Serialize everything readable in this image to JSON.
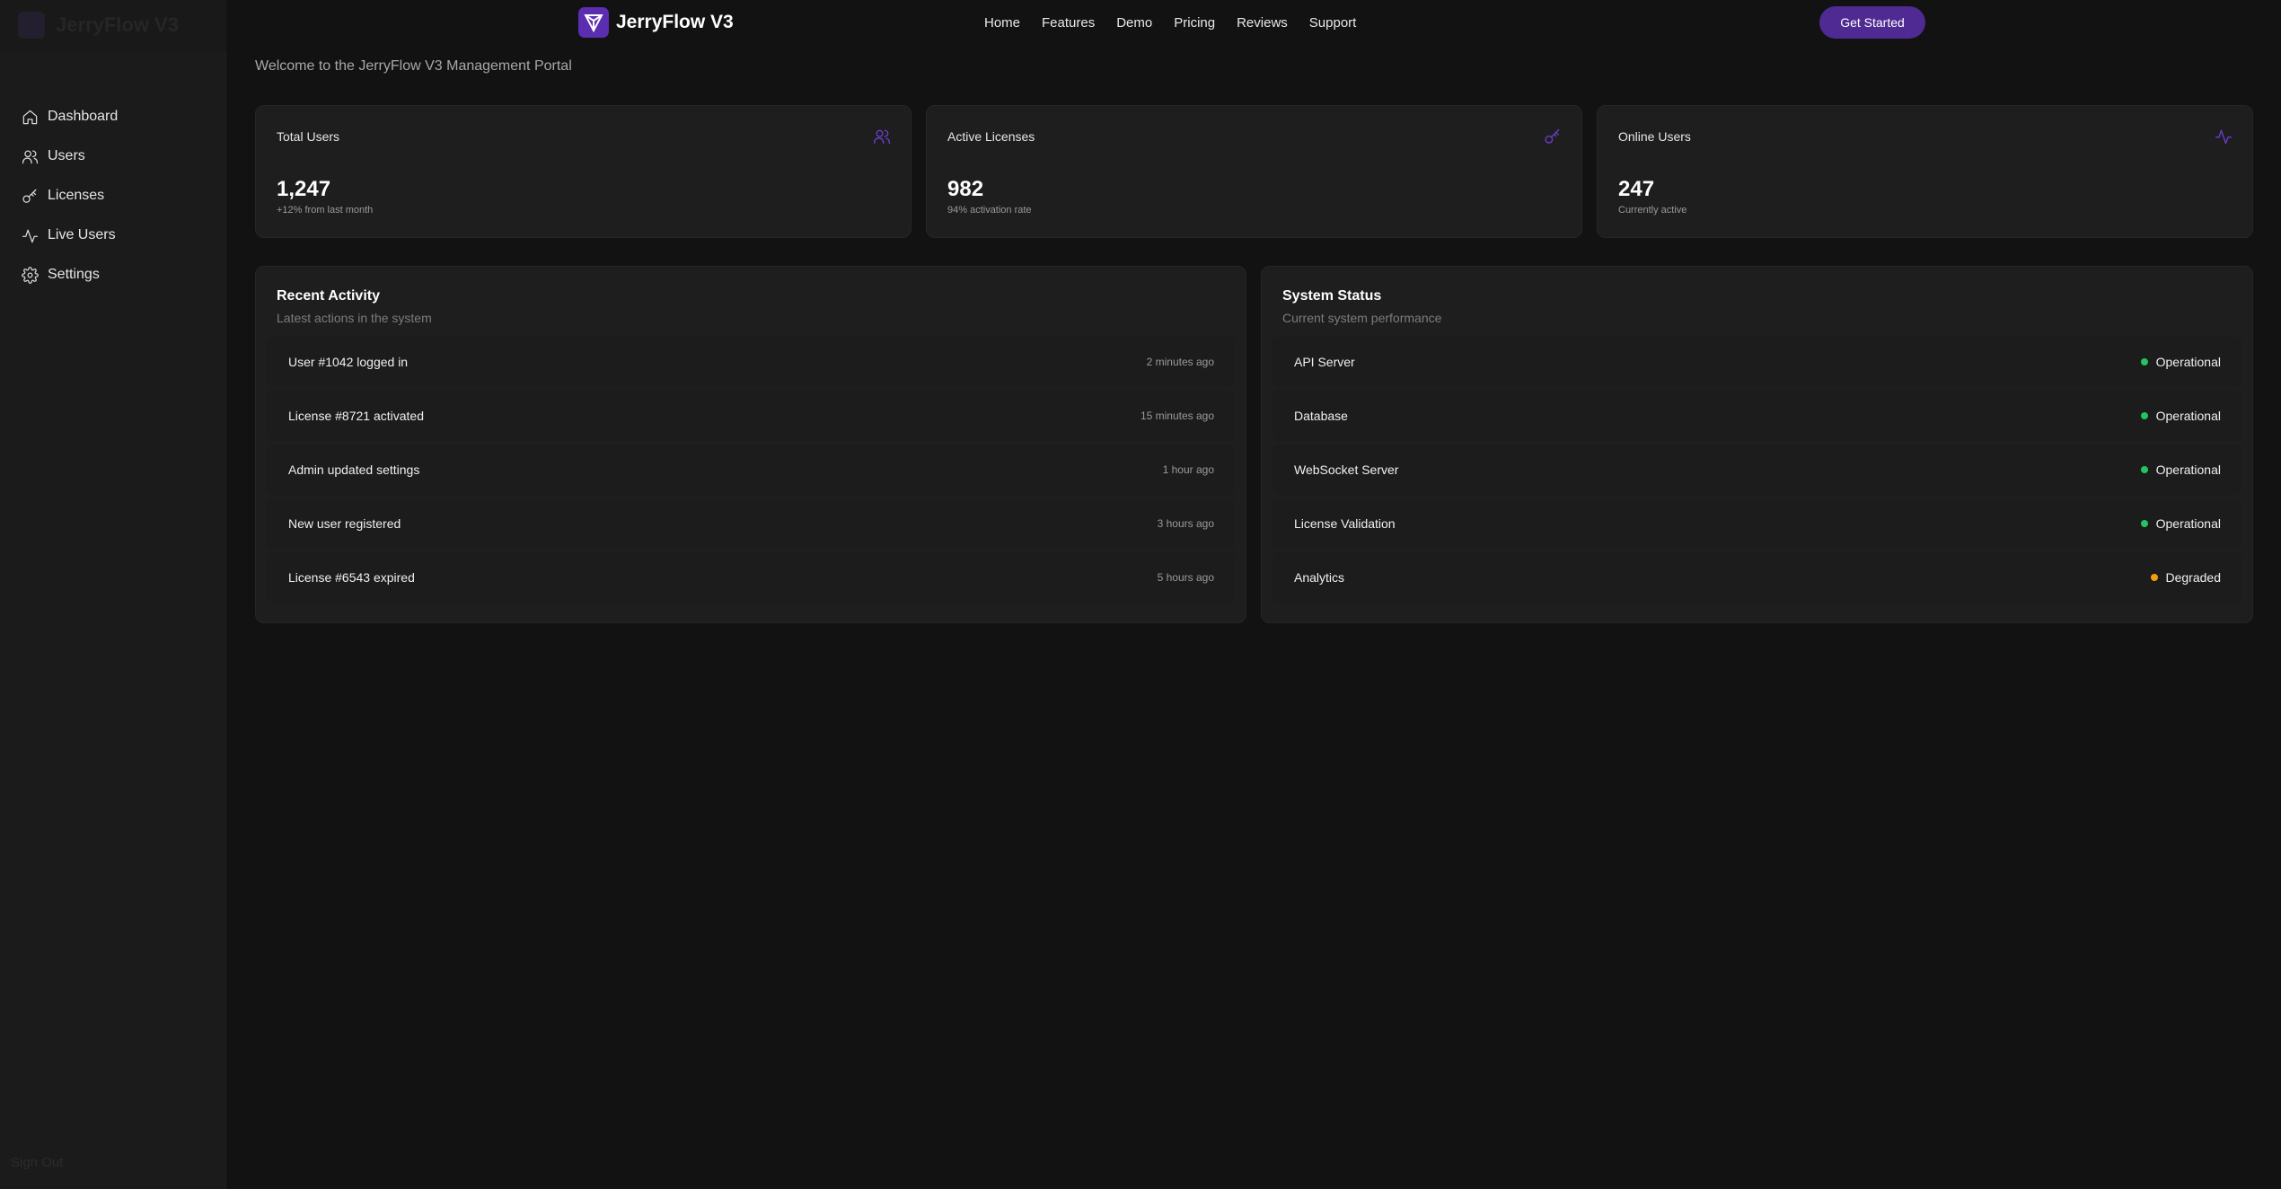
{
  "app": {
    "name": "JerryFlow V3"
  },
  "sidebar": {
    "items": [
      {
        "label": "Dashboard",
        "icon": "home-icon"
      },
      {
        "label": "Users",
        "icon": "users-icon"
      },
      {
        "label": "Licenses",
        "icon": "key-icon"
      },
      {
        "label": "Live Users",
        "icon": "activity-icon"
      },
      {
        "label": "Settings",
        "icon": "gear-icon"
      }
    ],
    "signout_label": "Sign Out"
  },
  "topnav": {
    "brand": "JerryFlow V3",
    "links": [
      "Home",
      "Features",
      "Demo",
      "Pricing",
      "Reviews",
      "Support"
    ],
    "cta_label": "Get Started",
    "accent": "#4f2a93"
  },
  "main": {
    "subtitle": "Welcome to the JerryFlow V3 Management Portal",
    "stats": [
      {
        "label": "Total Users",
        "value": "1,247",
        "note": "+12% from last month",
        "icon": "users-icon"
      },
      {
        "label": "Active Licenses",
        "value": "982",
        "note": "94% activation rate",
        "icon": "key-icon"
      },
      {
        "label": "Online Users",
        "value": "247",
        "note": "Currently active",
        "icon": "activity-icon"
      }
    ],
    "activity": {
      "title": "Recent Activity",
      "subtitle": "Latest actions in the system",
      "items": [
        {
          "text": "User #1042 logged in",
          "time": "2 minutes ago"
        },
        {
          "text": "License #8721 activated",
          "time": "15 minutes ago"
        },
        {
          "text": "Admin updated settings",
          "time": "1 hour ago"
        },
        {
          "text": "New user registered",
          "time": "3 hours ago"
        },
        {
          "text": "License #6543 expired",
          "time": "5 hours ago"
        }
      ]
    },
    "system": {
      "title": "System Status",
      "subtitle": "Current system performance",
      "items": [
        {
          "name": "API Server",
          "status": "Operational",
          "color": "#22c55e"
        },
        {
          "name": "Database",
          "status": "Operational",
          "color": "#22c55e"
        },
        {
          "name": "WebSocket Server",
          "status": "Operational",
          "color": "#22c55e"
        },
        {
          "name": "License Validation",
          "status": "Operational",
          "color": "#22c55e"
        },
        {
          "name": "Analytics",
          "status": "Degraded",
          "color": "#f59e0b"
        }
      ]
    }
  }
}
